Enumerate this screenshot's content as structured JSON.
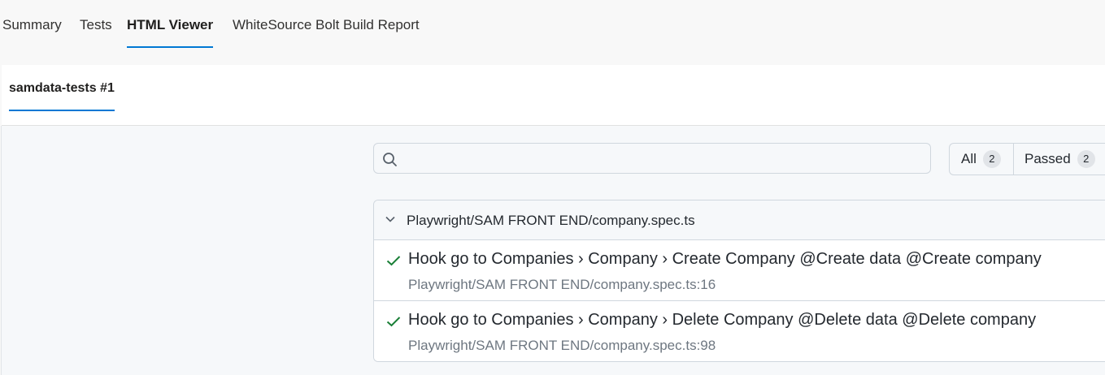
{
  "top_tabs": [
    {
      "label": "Summary",
      "active": false
    },
    {
      "label": "Tests",
      "active": false
    },
    {
      "label": "HTML Viewer",
      "active": true
    },
    {
      "label": "WhiteSource Bolt Build Report",
      "active": false
    }
  ],
  "sub_tab": {
    "label": "samdata-tests #1"
  },
  "search": {
    "value": "",
    "placeholder": ""
  },
  "filters": [
    {
      "label": "All",
      "count": "2"
    },
    {
      "label": "Passed",
      "count": "2"
    }
  ],
  "file_group": {
    "title": "Playwright/SAM FRONT END/company.spec.ts",
    "tests": [
      {
        "status": "passed",
        "title": "Hook go to Companies › Company › Create Company @Create data @Create company",
        "location": "Playwright/SAM FRONT END/company.spec.ts:16"
      },
      {
        "status": "passed",
        "title": "Hook go to Companies › Company › Delete Company @Delete data @Delete company",
        "location": "Playwright/SAM FRONT END/company.spec.ts:98"
      }
    ]
  },
  "colors": {
    "accent": "#0078d4",
    "passed": "#1a7f37",
    "text_secondary": "#6e7781"
  },
  "icons": [
    "search-icon",
    "chevron-down-icon",
    "check-icon"
  ]
}
